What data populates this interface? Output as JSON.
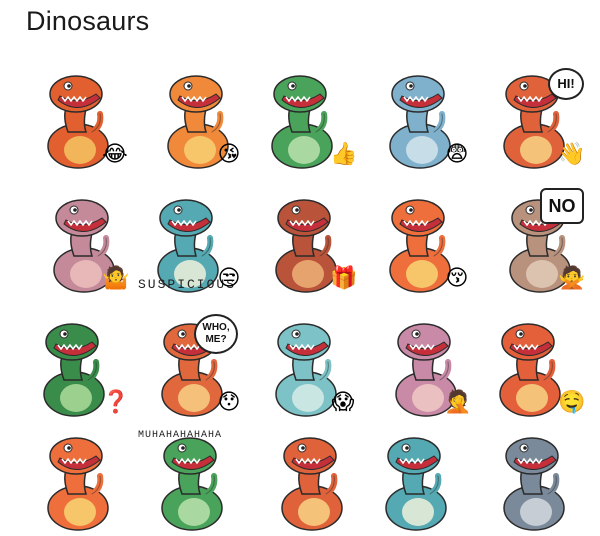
{
  "header": {
    "title": "Dinosaurs"
  },
  "stickers": [
    {
      "name": "trex-laughing",
      "emoji": "😂",
      "body": "#e2602f",
      "belly": "#f2b55a",
      "text": ""
    },
    {
      "name": "parasaurolophus-kiss",
      "emoji": "😘",
      "body": "#f1893a",
      "belly": "#f7c66a",
      "text": ""
    },
    {
      "name": "raptor-thumbsup",
      "emoji": "👍",
      "body": "#4aa35a",
      "belly": "#a9d9a0",
      "text": ""
    },
    {
      "name": "brachiosaurus-laptop",
      "emoji": "😨",
      "body": "#7fb0cc",
      "belly": "#c7dde8",
      "text": ""
    },
    {
      "name": "trex-hi",
      "emoji": "👋",
      "body": "#e0623a",
      "belly": "#f5c27a",
      "text": "HI!"
    },
    {
      "name": "triceratops-shrug",
      "emoji": "🤷",
      "body": "#c48a9a",
      "belly": "#e8b8b8",
      "text": ""
    },
    {
      "name": "iguanodon-suspicious",
      "emoji": "😒",
      "body": "#54a9b3",
      "belly": "#d8e6d6",
      "text": "SUSPICIOUS"
    },
    {
      "name": "pterodactyl-gift",
      "emoji": "🎁",
      "body": "#b9543a",
      "belly": "#e7a36e",
      "text": ""
    },
    {
      "name": "parasaurolophus-hearts",
      "emoji": "😚",
      "body": "#ee6e3c",
      "belly": "#f7c56a",
      "text": ""
    },
    {
      "name": "pachy-no",
      "emoji": "🙅",
      "body": "#b9927e",
      "belly": "#dcc3b0",
      "text": "NO"
    },
    {
      "name": "raptor-question",
      "emoji": "❓",
      "body": "#3a8c4a",
      "belly": "#9cd08f",
      "text": ""
    },
    {
      "name": "trex-who-me",
      "emoji": "😯",
      "body": "#e0683c",
      "belly": "#f5c07a",
      "text": "WHO, ME?"
    },
    {
      "name": "dino-screaming",
      "emoji": "😱",
      "body": "#7cc2c6",
      "belly": "#c9e6e2",
      "text": ""
    },
    {
      "name": "triceratops-facepalm",
      "emoji": "🤦",
      "body": "#c88aa6",
      "belly": "#ebc0c0",
      "text": ""
    },
    {
      "name": "trex-drooling",
      "emoji": "🤤",
      "body": "#e3603a",
      "belly": "#f5c27a",
      "text": ""
    },
    {
      "name": "parasaurolophus-peek",
      "emoji": "",
      "body": "#ee6e3c",
      "belly": "#f7c56a",
      "text": ""
    },
    {
      "name": "croc-muhaha",
      "emoji": "",
      "body": "#4aa35a",
      "belly": "#a9d9a0",
      "text": "MUHAHAHAHAHA"
    },
    {
      "name": "trex-peek",
      "emoji": "",
      "body": "#e0623a",
      "belly": "#f5c27a",
      "text": ""
    },
    {
      "name": "dino-thinking",
      "emoji": "",
      "body": "#54a9b3",
      "belly": "#d8e6d6",
      "text": ""
    },
    {
      "name": "dino-door",
      "emoji": "",
      "body": "#7a8a9a",
      "belly": "#c7cdd4",
      "text": ""
    }
  ]
}
